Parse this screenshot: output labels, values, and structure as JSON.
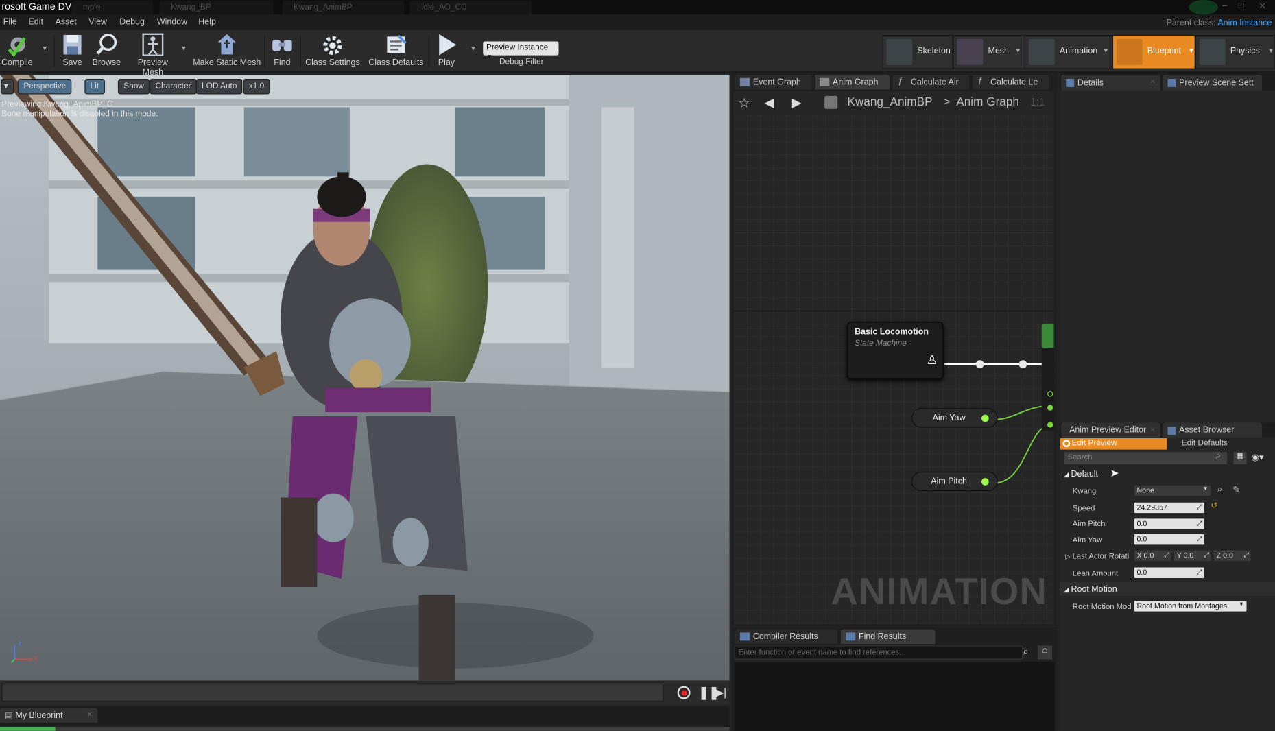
{
  "titlebar": {
    "title": "rosoft Game DVR",
    "tabs": [
      "mple",
      "Kwang_BP",
      "Kwang_AnimBP",
      "Idle_AO_CC"
    ]
  },
  "menubar": {
    "items": [
      "File",
      "Edit",
      "Asset",
      "View",
      "Debug",
      "Window",
      "Help"
    ],
    "parent_class_label": "Parent class:",
    "parent_class_value": "Anim Instance"
  },
  "toolbar": {
    "buttons": [
      {
        "label": "Compile",
        "icon": "compile-icon"
      },
      {
        "label": "Save",
        "icon": "save-icon"
      },
      {
        "label": "Browse",
        "icon": "browse-icon"
      },
      {
        "label": "Preview Mesh",
        "icon": "preview-mesh-icon"
      },
      {
        "label": "Make Static Mesh",
        "icon": "make-static-mesh-icon"
      },
      {
        "label": "Find",
        "icon": "find-icon"
      },
      {
        "label": "Class Settings",
        "icon": "class-settings-icon"
      },
      {
        "label": "Class Defaults",
        "icon": "class-defaults-icon"
      },
      {
        "label": "Play",
        "icon": "play-icon"
      }
    ],
    "preview_instance": "Preview Instance",
    "debug_filter": "Debug Filter",
    "modes": [
      {
        "label": "Skeleton",
        "icon": "skeleton-icon"
      },
      {
        "label": "Mesh",
        "icon": "mesh-icon"
      },
      {
        "label": "Animation",
        "icon": "animation-icon"
      },
      {
        "label": "Blueprint",
        "icon": "blueprint-icon",
        "active": true
      },
      {
        "label": "Physics",
        "icon": "physics-icon"
      }
    ],
    "active_color": "#e98b22"
  },
  "viewport": {
    "buttons": [
      "Perspective",
      "Lit",
      "Show",
      "Character",
      "LOD Auto",
      "x1.0"
    ],
    "info_line1": "Previewing Kwang_AnimBP_C.",
    "info_line2": "Bone manipulation is disabled in this mode.",
    "axis_z": "z",
    "axis_x": "x"
  },
  "bottom": {
    "my_blueprint_tab": "My Blueprint"
  },
  "graph": {
    "tabs": [
      "Event Graph",
      "Anim Graph",
      "Calculate Air",
      "Calculate Le"
    ],
    "breadcrumb_root": "Kwang_AnimBP",
    "breadcrumb_sep": ">",
    "breadcrumb_current": "Anim Graph",
    "zoom": "1:1",
    "node_title": "Basic Locomotion",
    "node_subtitle": "State Machine",
    "var_aim_yaw": "Aim Yaw",
    "var_aim_pitch": "Aim Pitch",
    "watermark": "ANIMATION",
    "pin_color": "#9bff4a"
  },
  "results": {
    "tabs": [
      "Compiler Results",
      "Find Results"
    ],
    "find_placeholder": "Enter function or event name to find references..."
  },
  "details": {
    "tabs": [
      "Details",
      "Preview Scene Sett"
    ]
  },
  "anim_preview": {
    "tabs": [
      "Anim Preview Editor",
      "Asset Browser"
    ],
    "edit_preview": "Edit Preview",
    "edit_defaults": "Edit Defaults",
    "search_placeholder": "Search",
    "section_default": "Default",
    "rows": {
      "kwang_label": "Kwang",
      "kwang_value": "None",
      "speed_label": "Speed",
      "speed_value": "24.29357",
      "aim_pitch_label": "Aim Pitch",
      "aim_pitch_value": "0.0",
      "aim_yaw_label": "Aim Yaw",
      "aim_yaw_value": "0.0",
      "last_actor_label": "Last Actor Rotati",
      "x_value": "X 0.0",
      "y_value": "Y 0.0",
      "z_value": "Z 0.0",
      "lean_label": "Lean Amount",
      "lean_value": "0.0"
    },
    "section_root_motion": "Root Motion",
    "root_motion_label": "Root Motion Mod",
    "root_motion_value": "Root Motion from Montages"
  }
}
